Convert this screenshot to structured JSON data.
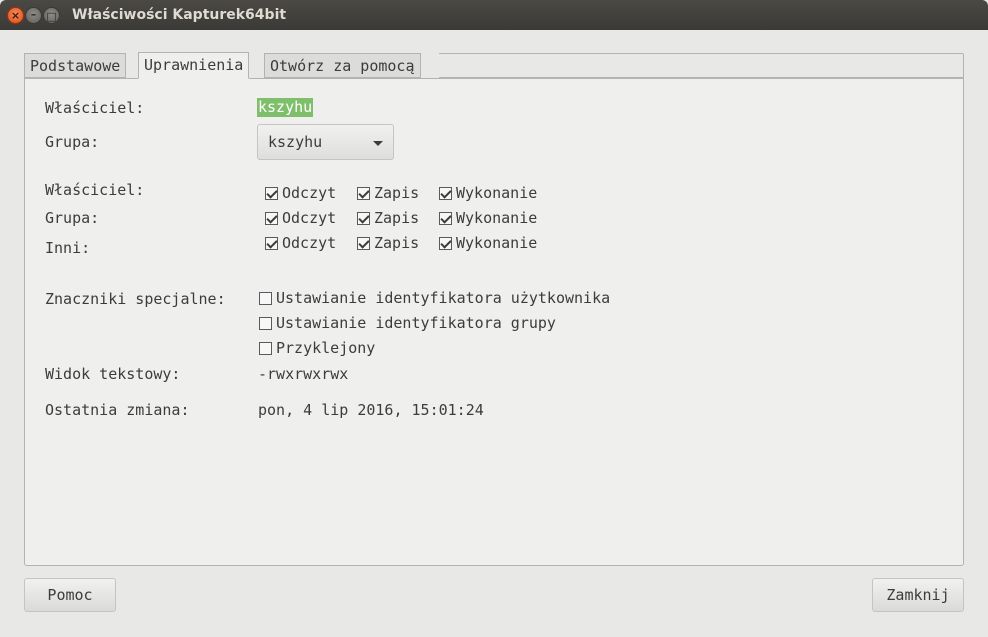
{
  "window": {
    "title": "Właściwości Kapturek64bit",
    "close_symbol": "×",
    "min_symbol": "–",
    "max_symbol": "□"
  },
  "tabs": [
    {
      "label": "Podstawowe",
      "active": false
    },
    {
      "label": "Uprawnienia",
      "active": true
    },
    {
      "label": "Otwórz za pomocą",
      "active": false
    }
  ],
  "ownership": {
    "owner_label": "Właściciel:",
    "owner_value": "kszyhu",
    "group_label": "Grupa:",
    "group_value": "kszyhu"
  },
  "access": {
    "rows": [
      {
        "label": "Właściciel:",
        "read": "Odczyt",
        "write": "Zapis",
        "exec": "Wykonanie",
        "read_checked": true,
        "write_checked": true,
        "exec_checked": true
      },
      {
        "label": "Grupa:",
        "read": "Odczyt",
        "write": "Zapis",
        "exec": "Wykonanie",
        "read_checked": true,
        "write_checked": true,
        "exec_checked": true
      },
      {
        "label": "Inni:",
        "read": "Odczyt",
        "write": "Zapis",
        "exec": "Wykonanie",
        "read_checked": true,
        "write_checked": true,
        "exec_checked": true
      }
    ]
  },
  "special": {
    "label": "Znaczniki specjalne:",
    "flags": [
      {
        "label": "Ustawianie identyfikatora użytkownika",
        "checked": false
      },
      {
        "label": "Ustawianie identyfikatora grupy",
        "checked": false
      },
      {
        "label": "Przyklejony",
        "checked": false
      }
    ]
  },
  "text_view": {
    "label": "Widok tekstowy:",
    "value": "-rwxrwxrwx"
  },
  "last_change": {
    "label": "Ostatnia zmiana:",
    "value": "pon, 4 lip 2016, 15:01:24"
  },
  "buttons": {
    "help": "Pomoc",
    "close": "Zamknij"
  },
  "colors": {
    "selection": "#7fbf6b",
    "titlebar": "#3c3b37",
    "close_button": "#e95420"
  }
}
